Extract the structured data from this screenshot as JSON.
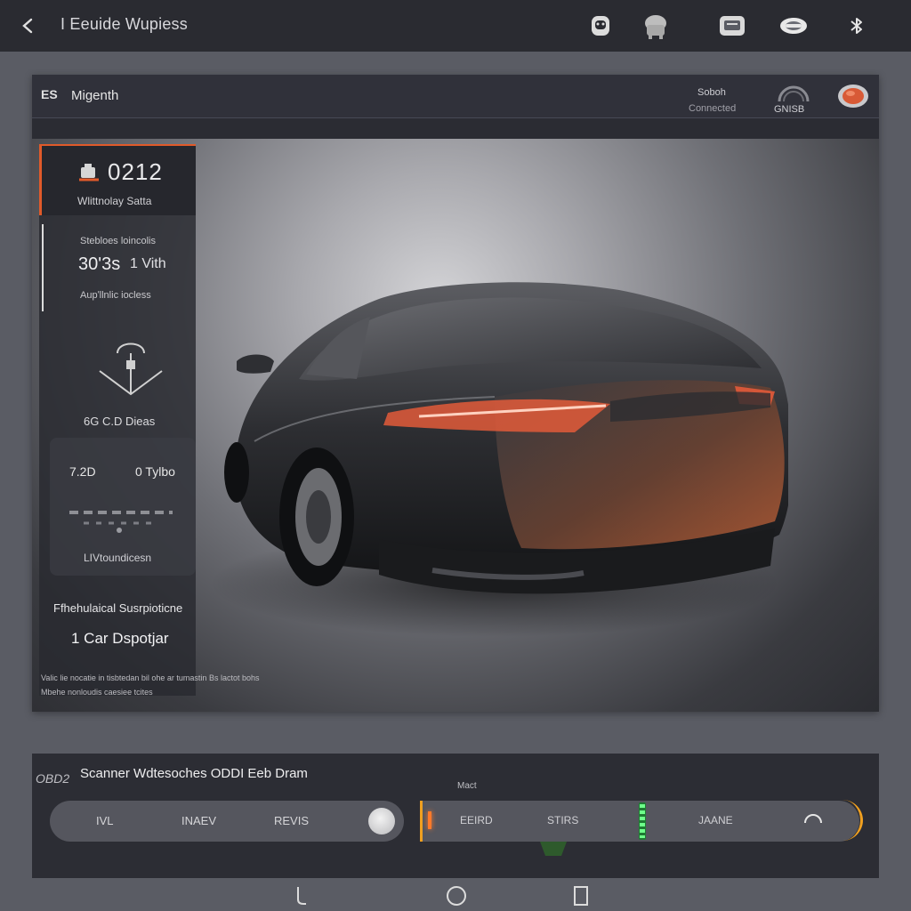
{
  "topbar": {
    "back_icon": "arrow-left-icon",
    "title": "I Eeuide Wupiess",
    "icons": [
      "android-icon",
      "car-dashboard-icon",
      "printer-icon",
      "gauge-icon",
      "bluetooth-icon"
    ]
  },
  "panel": {
    "header": {
      "logo": "ES",
      "brand": "Migenth",
      "status_title": "Soboh",
      "status_sub": "Connected",
      "gauge_label": "GNISB",
      "badge_icon": "alert-badge-icon"
    },
    "sidebar": {
      "code": "0212",
      "caption": "Wlittnolay Satta",
      "section_label": "Stebloes loincolis",
      "metric_1": "30ʹ3s",
      "metric_2": "1 Vith",
      "metric_sub": "Aupʹllnlic iocless",
      "sensor_label": "6G C.D Dieas",
      "sub_value": "7.2D",
      "sub_unit": "0 Tylbo",
      "sub_caption": "LIVtoundicesn"
    },
    "viewport": {
      "text_1": "Ffhehulaical Susrpioticne",
      "text_2": "1 Car Dspotjar",
      "footnote_1": "Valic lie nocatie in tisbtedan bil ohe ar tumastin Bs lactot bohs",
      "footnote_2": "Mbehe nonloudis caesiee tcites"
    }
  },
  "bottom_panel": {
    "logo": "OBD2",
    "title": "Scanner Wdtesoches ODDI Eeb Dram",
    "small_label": "Mact",
    "gear_selector": {
      "options": [
        "IVL",
        "INAEV",
        "REVIS"
      ]
    },
    "mode_bar": {
      "labels": [
        "EEIRD",
        "STIRS",
        "JAANE"
      ],
      "level_fraction": 0.5
    }
  },
  "navbar": {
    "icons": [
      "back-gesture-icon",
      "home-icon",
      "recents-icon"
    ]
  },
  "colors": {
    "accent_orange": "#e05a2a",
    "accent_amber": "#f0a020",
    "status_green": "#3ddc5a",
    "panel_dark": "#2b2c33"
  }
}
